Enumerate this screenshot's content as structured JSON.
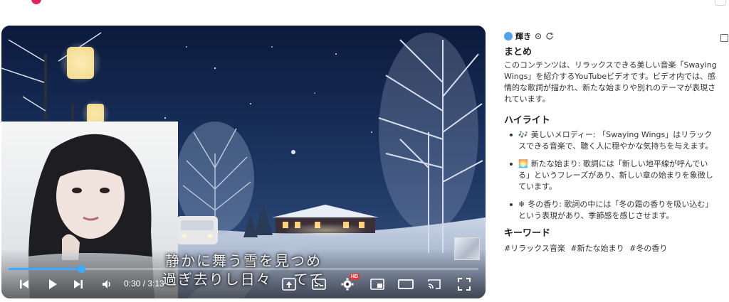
{
  "player": {
    "lyrics_line1": "静かに舞う雪を見つめ",
    "lyrics_line2": "過ぎ去りし日々　 てて",
    "current_time": "0:30",
    "duration": "3:13",
    "progress_fraction": 0.155,
    "settings_badge": "HD",
    "icons": [
      "previous-icon",
      "play-icon",
      "next-icon",
      "volume-icon",
      "miniplayer-share-icon",
      "subtitles-icon",
      "settings-icon",
      "miniplayer-icon",
      "theater-icon",
      "cast-icon",
      "fullscreen-icon"
    ]
  },
  "panel": {
    "brand": "輝き",
    "summary_title": "まとめ",
    "summary_text": "このコンテンツは、リラックスできる美しい音楽「Swaying Wings」を紹介するYouTubeビデオです。ビデオ内では、感情的な歌詞が描かれ、新たな始まりや別れのテーマが表現されています。",
    "highlights_title": "ハイライト",
    "highlights": [
      {
        "emoji": "🎶",
        "text": "美しいメロディー: 「Swaying Wings」はリラックスできる音楽で、聴く人に穏やかな気持ちを与えます。"
      },
      {
        "emoji": "🌅",
        "text": "新たな始まり: 歌詞には「新しい地平線が呼んでいる」というフレーズがあり、新しい章の始まりを象徴しています。"
      },
      {
        "emoji": "❄",
        "text": "冬の香り: 歌詞の中には「冬の霜の香りを吸い込む」という表現があり、季節感を感じさせます。"
      }
    ],
    "keywords_title": "キーワード",
    "keywords": [
      "#リラックス音楽",
      "#新たな始まり",
      "#冬の香り"
    ]
  },
  "colors": {
    "progress": "#3da9ff",
    "night_sky": "#142243",
    "brand_icon": "#4fa3e8"
  }
}
